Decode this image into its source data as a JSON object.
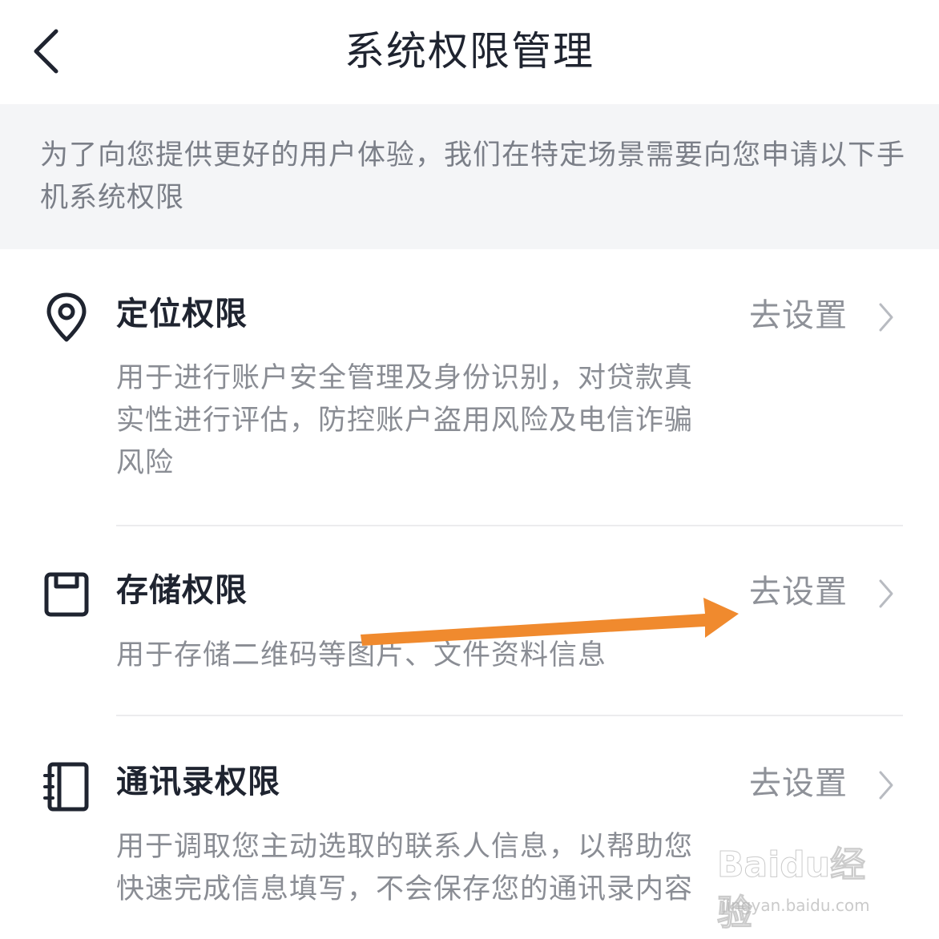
{
  "header": {
    "title": "系统权限管理",
    "back_icon": "chevron-left-icon"
  },
  "notice": {
    "text": "为了向您提供更好的用户体验，我们在特定场景需要向您申请以下手机系统权限"
  },
  "permissions": [
    {
      "icon": "location-pin-icon",
      "title": "定位权限",
      "action_label": "去设置",
      "description": "用于进行账户安全管理及身份识别，对贷款真实性进行评估，防控账户盗用风险及电信诈骗风险"
    },
    {
      "icon": "storage-box-icon",
      "title": "存储权限",
      "action_label": "去设置",
      "description": "用于存储二维码等图片、文件资料信息"
    },
    {
      "icon": "contacts-book-icon",
      "title": "通讯录权限",
      "action_label": "去设置",
      "description": "用于调取您主动选取的联系人信息，以帮助您快速完成信息填写，不会保存您的通讯录内容"
    }
  ],
  "watermark": {
    "logo": "Baidu经验",
    "url": "jingyan.baidu.com"
  },
  "colors": {
    "annotation_arrow": "#f08a2e",
    "notice_background": "#f4f5f7",
    "title_text": "#1f2430",
    "secondary_text": "#8a8d94"
  }
}
